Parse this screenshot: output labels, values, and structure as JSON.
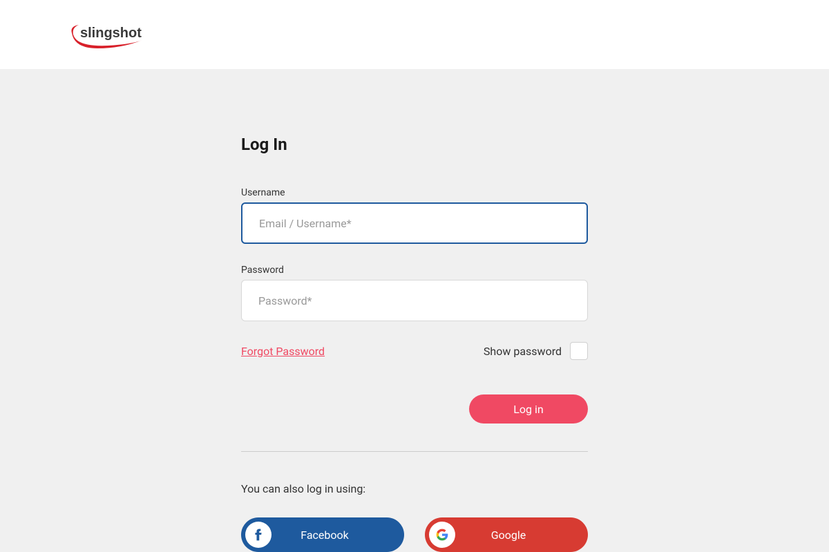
{
  "brand": {
    "name": "slingshot"
  },
  "form": {
    "title": "Log In",
    "username_label": "Username",
    "username_placeholder": "Email / Username*",
    "password_label": "Password",
    "password_placeholder": "Password*",
    "forgot_password": "Forgot Password",
    "show_password_label": "Show password",
    "login_button": "Log in",
    "social_label": "You can also log in using:",
    "facebook_label": "Facebook",
    "google_label": "Google"
  },
  "colors": {
    "accent": "#f04963",
    "facebook": "#1e5a9e",
    "google": "#d73b32"
  }
}
